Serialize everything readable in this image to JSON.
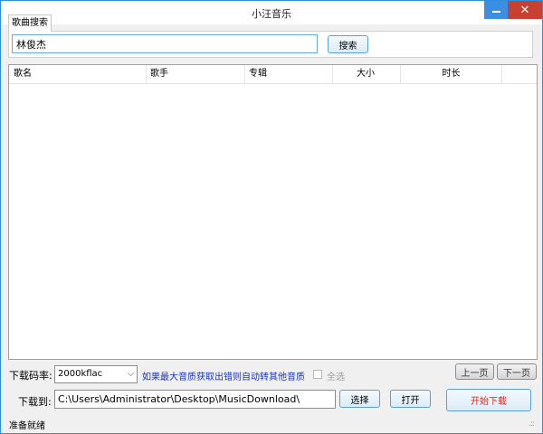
{
  "window": {
    "title": "小汪音乐",
    "minimize_icon": "minimize-icon",
    "close_icon": "close-icon",
    "close_glyph": "✕"
  },
  "search_tab": {
    "label": "歌曲搜索"
  },
  "search": {
    "value": "林俊杰",
    "button_label": "搜索"
  },
  "results_table": {
    "columns": [
      "歌名",
      "歌手",
      "专辑",
      "大小",
      "时长"
    ],
    "rows": []
  },
  "download_options": {
    "bitrate_label": "下载码率:",
    "bitrate_selected": "2000kflac",
    "dropdown_icon": "chevron-down-icon",
    "dropdown_glyph": "⌵",
    "hint": "如果最大音质获取出错则自动转其他音质",
    "select_all_label": "全选",
    "select_all_checked": false,
    "prev_page_label": "上一页",
    "next_page_label": "下一页"
  },
  "download_dir": {
    "label": "下载到:",
    "value": "C:\\Users\\Administrator\\Desktop\\MusicDownload\\",
    "choose_label": "选择",
    "open_label": "打开",
    "start_label": "开始下载"
  },
  "status_bar": {
    "text": "准备就绪",
    "grip_icon": "resize-grip-icon",
    "grip_glyph": ".::"
  },
  "colors": {
    "window_border": "#2b90d9",
    "close_button": "#c84031",
    "minimize_button": "#3b8ee3",
    "hint_text": "#1a33c4",
    "start_text": "#e1251b"
  }
}
